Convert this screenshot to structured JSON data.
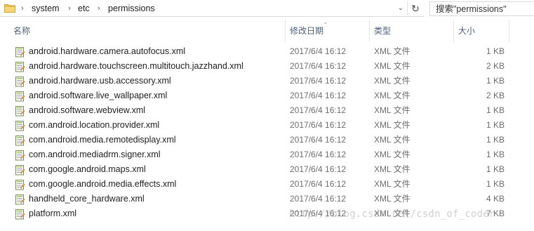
{
  "address_bar": {
    "breadcrumb": [
      "system",
      "etc",
      "permissions"
    ],
    "separator": "›",
    "dropdown_glyph": "⌄",
    "refresh_glyph": "↻"
  },
  "search": {
    "placeholder": "搜索\"permissions\""
  },
  "columns": {
    "name": "名称",
    "modified": "修改日期",
    "type": "类型",
    "size": "大小"
  },
  "files": [
    {
      "name": "android.hardware.camera.autofocus.xml",
      "modified": "2017/6/4 16:12",
      "type": "XML 文件",
      "size": "1 KB"
    },
    {
      "name": "android.hardware.touchscreen.multitouch.jazzhand.xml",
      "modified": "2017/6/4 16:12",
      "type": "XML 文件",
      "size": "2 KB"
    },
    {
      "name": "android.hardware.usb.accessory.xml",
      "modified": "2017/6/4 16:12",
      "type": "XML 文件",
      "size": "1 KB"
    },
    {
      "name": "android.software.live_wallpaper.xml",
      "modified": "2017/6/4 16:12",
      "type": "XML 文件",
      "size": "2 KB"
    },
    {
      "name": "android.software.webview.xml",
      "modified": "2017/6/4 16:12",
      "type": "XML 文件",
      "size": "1 KB"
    },
    {
      "name": "com.android.location.provider.xml",
      "modified": "2017/6/4 16:12",
      "type": "XML 文件",
      "size": "1 KB"
    },
    {
      "name": "com.android.media.remotedisplay.xml",
      "modified": "2017/6/4 16:12",
      "type": "XML 文件",
      "size": "1 KB"
    },
    {
      "name": "com.android.mediadrm.signer.xml",
      "modified": "2017/6/4 16:12",
      "type": "XML 文件",
      "size": "1 KB"
    },
    {
      "name": "com.google.android.maps.xml",
      "modified": "2017/6/4 16:12",
      "type": "XML 文件",
      "size": "1 KB"
    },
    {
      "name": "com.google.android.media.effects.xml",
      "modified": "2017/6/4 16:12",
      "type": "XML 文件",
      "size": "1 KB"
    },
    {
      "name": "handheld_core_hardware.xml",
      "modified": "2017/6/4 16:12",
      "type": "XML 文件",
      "size": "4 KB"
    },
    {
      "name": "platform.xml",
      "modified": "2017/6/4 16:12",
      "type": "XML 文件",
      "size": "7 KB"
    }
  ],
  "watermark": "http://blog.csdn.net/csdn_of_coder",
  "icons": {
    "folder": "folder-icon",
    "file": "xml-file-icon",
    "sort": "sort-arrow-icon"
  },
  "colors": {
    "header_text": "#4c607a",
    "secondary_text": "#6d6d6d",
    "folder": "#e8b84a"
  }
}
